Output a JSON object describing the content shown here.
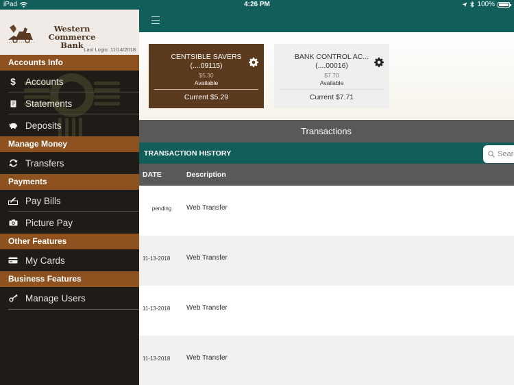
{
  "status_bar": {
    "device": "iPad",
    "time": "4:26 PM",
    "battery": "100%",
    "battery_level": 1.0
  },
  "sidebar": {
    "bank_name_line1": "Western Commerce",
    "bank_name_line2": "Bank",
    "last_login": "Last Login:  11/14/2018",
    "sections": [
      {
        "header": "Accounts Info",
        "items": [
          {
            "label": "Accounts",
            "icon": "dollar-icon"
          },
          {
            "label": "Statements",
            "icon": "document-icon"
          },
          {
            "label": "Deposits",
            "icon": "piggy-bank-icon"
          }
        ]
      },
      {
        "header": "Manage Money",
        "items": [
          {
            "label": "Transfers",
            "icon": "refresh-icon"
          }
        ]
      },
      {
        "header": "Payments",
        "items": [
          {
            "label": "Pay Bills",
            "icon": "check-sign-icon"
          },
          {
            "label": "Picture Pay",
            "icon": "camera-icon"
          }
        ]
      },
      {
        "header": "Other Features",
        "items": [
          {
            "label": "My Cards",
            "icon": "credit-card-icon"
          }
        ]
      },
      {
        "header": "Business Features",
        "items": [
          {
            "label": "Manage Users",
            "icon": "key-icon"
          }
        ]
      }
    ]
  },
  "accounts": [
    {
      "name": "CENTSIBLE SAVERS",
      "number": "(....09115)",
      "available_amount": "$5.30",
      "available_label": "Available",
      "current": "Current $5.29",
      "selected": true
    },
    {
      "name": "BANK CONTROL AC...",
      "number": "(....00016)",
      "available_amount": "$7.70",
      "available_label": "Available",
      "current": "Current $7.71",
      "selected": false
    }
  ],
  "transactions": {
    "title": "Transactions",
    "history_label": "TRANSACTION HISTORY",
    "search_placeholder": "Search",
    "columns": {
      "date": "DATE",
      "description": "Description"
    },
    "rows": [
      {
        "date": "pending",
        "description": "Web Transfer"
      },
      {
        "date": "11-13-2018",
        "description": "Web Transfer"
      },
      {
        "date": "11-13-2018",
        "description": "Web Transfer"
      },
      {
        "date": "11-13-2018",
        "description": "Web Transfer"
      }
    ]
  },
  "colors": {
    "teal": "#115e5a",
    "section_brown": "#8e5220",
    "card_brown": "#5b3a1e",
    "header_gray": "#595959"
  }
}
